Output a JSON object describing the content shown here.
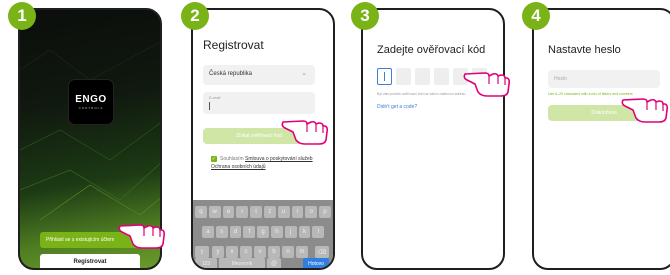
{
  "steps": [
    "1",
    "2",
    "3",
    "4"
  ],
  "screen1": {
    "logo_text": "ENGO",
    "logo_subtext": "CONTROLS",
    "login_button": "Přihlásit se s existujícím účtem",
    "register_button": "Registrovat"
  },
  "screen2": {
    "title": "Registrovat",
    "country": "Česká republika",
    "email_label": "E-mail",
    "verify_button": "Získat ověřovací kód",
    "consent_prefix": "Souhlasím ",
    "consent_link1": "Smlouva o poskytování služeb",
    "consent_link2": "Ochrana osobních údajů",
    "keyboard_row1": [
      "q",
      "w",
      "e",
      "r",
      "t",
      "z",
      "u",
      "i",
      "o",
      "p"
    ],
    "keyboard_row2": [
      "a",
      "s",
      "d",
      "f",
      "g",
      "h",
      "j",
      "k",
      "l"
    ],
    "keyboard_row3": [
      "y",
      "x",
      "c",
      "v",
      "b",
      "n",
      "m"
    ],
    "key_numbers": "123",
    "key_space": "Mezerník",
    "key_at": "@",
    "key_done": "Hotovo"
  },
  "screen3": {
    "title": "Zadejte ověřovací kód",
    "hint": "Byl vám poslán ověřovací kód na vaši e-mailovou adresu.",
    "resend_link": "Didn't get a code?"
  },
  "screen4": {
    "title": "Nastavte heslo",
    "password_placeholder": "Heslo",
    "hint": "Use 6–20 characters with a mix of letters and numbers",
    "done_button": "Dokončeno"
  },
  "colors": {
    "accent": "#7ab317",
    "accent_light": "#cfe6a6",
    "link": "#3b7fd6"
  }
}
